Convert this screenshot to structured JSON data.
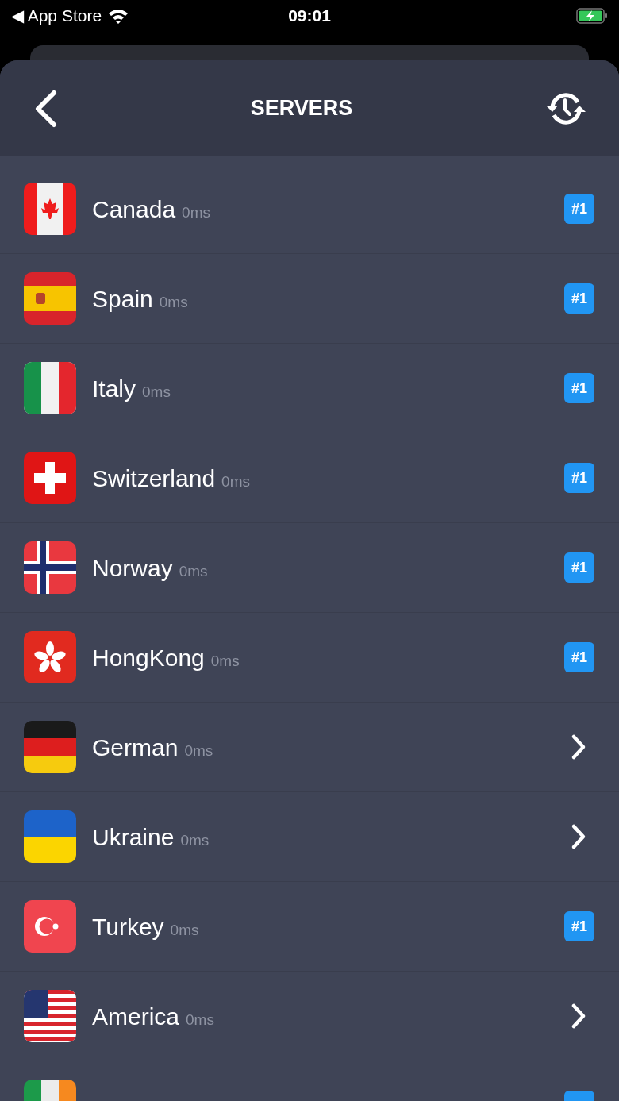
{
  "status_bar": {
    "back_label": "◀ App Store",
    "time": "09:01"
  },
  "header": {
    "title": "SERVERS"
  },
  "servers": [
    {
      "name": "Canada",
      "latency": "0ms",
      "accessory": {
        "kind": "badge",
        "label": "#1"
      }
    },
    {
      "name": "Spain",
      "latency": "0ms",
      "accessory": {
        "kind": "badge",
        "label": "#1"
      }
    },
    {
      "name": "Italy",
      "latency": "0ms",
      "accessory": {
        "kind": "badge",
        "label": "#1"
      }
    },
    {
      "name": "Switzerland",
      "latency": "0ms",
      "accessory": {
        "kind": "badge",
        "label": "#1"
      }
    },
    {
      "name": "Norway",
      "latency": "0ms",
      "accessory": {
        "kind": "badge",
        "label": "#1"
      }
    },
    {
      "name": "HongKong",
      "latency": "0ms",
      "accessory": {
        "kind": "badge",
        "label": "#1"
      }
    },
    {
      "name": "German",
      "latency": "0ms",
      "accessory": {
        "kind": "chevron"
      }
    },
    {
      "name": "Ukraine",
      "latency": "0ms",
      "accessory": {
        "kind": "chevron"
      }
    },
    {
      "name": "Turkey",
      "latency": "0ms",
      "accessory": {
        "kind": "badge",
        "label": "#1"
      }
    },
    {
      "name": "America",
      "latency": "0ms",
      "accessory": {
        "kind": "chevron"
      }
    },
    {
      "accessory": {
        "kind": "badge"
      }
    }
  ]
}
